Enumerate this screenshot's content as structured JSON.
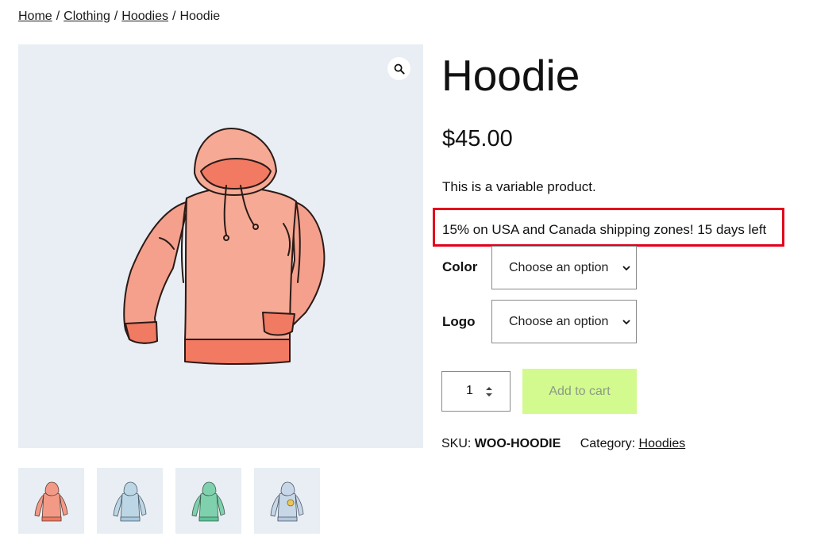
{
  "breadcrumb": {
    "home": "Home",
    "clothing": "Clothing",
    "hoodies": "Hoodies",
    "current": "Hoodie",
    "separator": "/"
  },
  "product": {
    "title": "Hoodie",
    "price": "$45.00",
    "description": "This is a variable product.",
    "promo_notice": "15% on USA and Canada shipping zones! 15 days left",
    "variations": {
      "color": {
        "label": "Color",
        "selected": "Choose an option"
      },
      "logo": {
        "label": "Logo",
        "selected": "Choose an option"
      }
    },
    "quantity": "1",
    "add_to_cart_label": "Add to cart",
    "sku_label": "SKU:",
    "sku": "WOO-HOODIE",
    "category_label": "Category:",
    "category": "Hoodies"
  },
  "gallery": {
    "zoom_icon": "magnifier-icon",
    "main_image": {
      "description": "pink hoodie",
      "color": "#f29a86"
    },
    "thumbnails": [
      {
        "name": "pink hoodie",
        "color": "#f29a86"
      },
      {
        "name": "light blue hoodie",
        "color": "#bcd6e6"
      },
      {
        "name": "green hoodie",
        "color": "#7fd1ad"
      },
      {
        "name": "blue hoodie with logo",
        "color": "#c7d7e8"
      }
    ]
  },
  "colors": {
    "image_background": "#e8eef3",
    "promo_border": "#e3001b",
    "add_to_cart_bg": "#d3fa8f",
    "add_to_cart_text": "#8c9a86"
  }
}
